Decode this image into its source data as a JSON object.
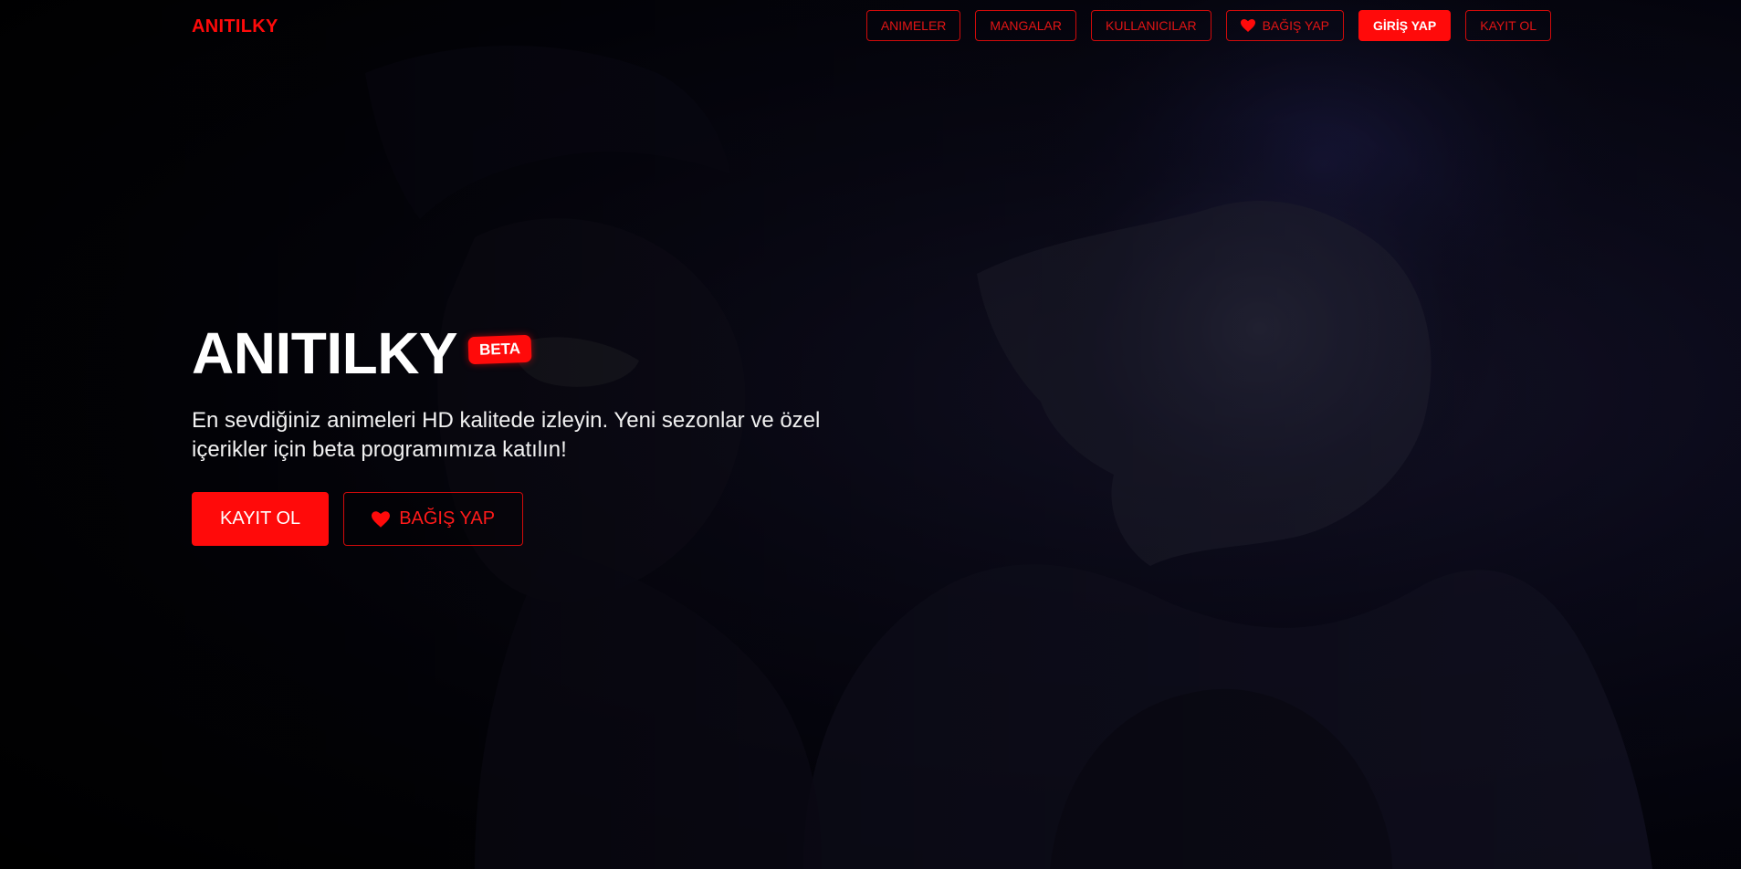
{
  "nav": {
    "brand": "ANITILKY",
    "links": [
      {
        "label": "ANIMELER"
      },
      {
        "label": "MANGALAR"
      },
      {
        "label": "KULLANICILAR"
      },
      {
        "label": "BAĞIŞ YAP",
        "icon": "heart-icon"
      },
      {
        "label": "GİRİŞ YAP"
      },
      {
        "label": "KAYIT OL"
      }
    ]
  },
  "hero": {
    "title": "ANITILKY",
    "badge": "BETA",
    "subtitle": "En sevdiğiniz animeleri HD kalitede izleyin. Yeni sezonlar ve özel içerikler için beta programımıza katılın!",
    "primary_cta": "KAYIT OL",
    "secondary_cta": "BAĞIŞ YAP"
  },
  "colors": {
    "accent": "#ff0a0a",
    "background": "#000000",
    "text": "#ffffff"
  }
}
